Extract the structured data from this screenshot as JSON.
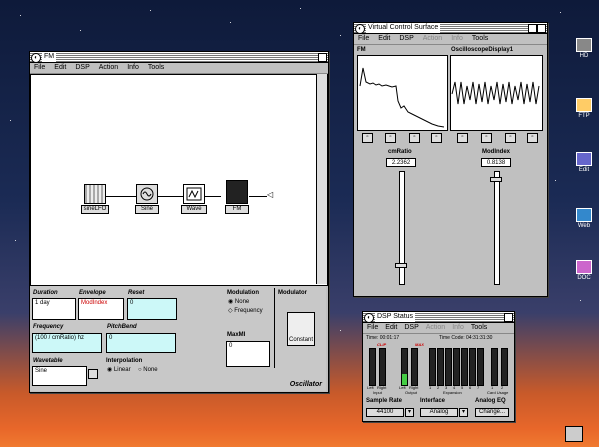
{
  "fm_window": {
    "title": "FM",
    "menu": [
      "File",
      "Edit",
      "DSP",
      "Action",
      "Info",
      "Tools"
    ],
    "nodes": [
      "sineLFO",
      "Sine",
      "Wave",
      "FM"
    ],
    "fields": {
      "duration_label": "Duration",
      "duration_value": "1 day",
      "envelope_label": "Envelope",
      "envelope_value": "ModIndex",
      "reset_label": "Reset",
      "reset_value": "0",
      "frequency_label": "Frequency",
      "frequency_value": "(100 / cmRatio) hz",
      "pitchbend_label": "PitchBend",
      "pitchbend_value": "0",
      "wavetable_label": "Wavetable",
      "wavetable_value": "Sine",
      "interpolation_label": "Interpolation",
      "interp_linear": "Linear",
      "interp_none": "None",
      "modulation_label": "Modulation",
      "mod_none": "None",
      "mod_frequency": "Frequency",
      "modulator_label": "Modulator",
      "constant_btn": "Constant",
      "maxmi_label": "MaxMI",
      "maxmi_value": "0",
      "footer": "Oscillator"
    }
  },
  "vcs_window": {
    "title": "Virtual Control Surface",
    "menu": [
      "File",
      "Edit",
      "DSP",
      "Action",
      "Info",
      "Tools"
    ],
    "dim_menu": [
      false,
      false,
      false,
      true,
      true,
      false
    ],
    "scope1_label": "FM",
    "scope2_label": "OscilloscopeDisplay1",
    "ctrl1_label": "cmRatio",
    "ctrl1_value": "2.2362",
    "ctrl2_label": "ModIndex",
    "ctrl2_value": "0.8138",
    "ctrl1_level": 0.1,
    "ctrl2_level": 0.92
  },
  "dsp_window": {
    "title": "DSP Status",
    "menu": [
      "File",
      "Edit",
      "DSP",
      "Action",
      "Info",
      "Tools"
    ],
    "dim_menu": [
      false,
      false,
      false,
      true,
      true,
      false
    ],
    "time": "Time: 00:01:17",
    "timecode": "Time Code: 04:31:31:30",
    "clip": "CLIP",
    "max": "MAX",
    "input": "Input",
    "output": "Output",
    "expansion": "Expansion",
    "card_usage": "Card Usage",
    "left": "Left",
    "right": "Right",
    "expansion_nums": [
      "1",
      "2",
      "3",
      "4",
      "5",
      "6",
      "7",
      "1",
      "2"
    ],
    "sample_rate_label": "Sample Rate",
    "sample_rate_value": "44100",
    "interface_label": "Interface",
    "interface_value": "Analog",
    "analog_eq_label": "Analog EQ",
    "change_btn": "Change..."
  },
  "desktop_icons": [
    "HD",
    "FTP",
    "Edit",
    "Web",
    "DOC"
  ]
}
